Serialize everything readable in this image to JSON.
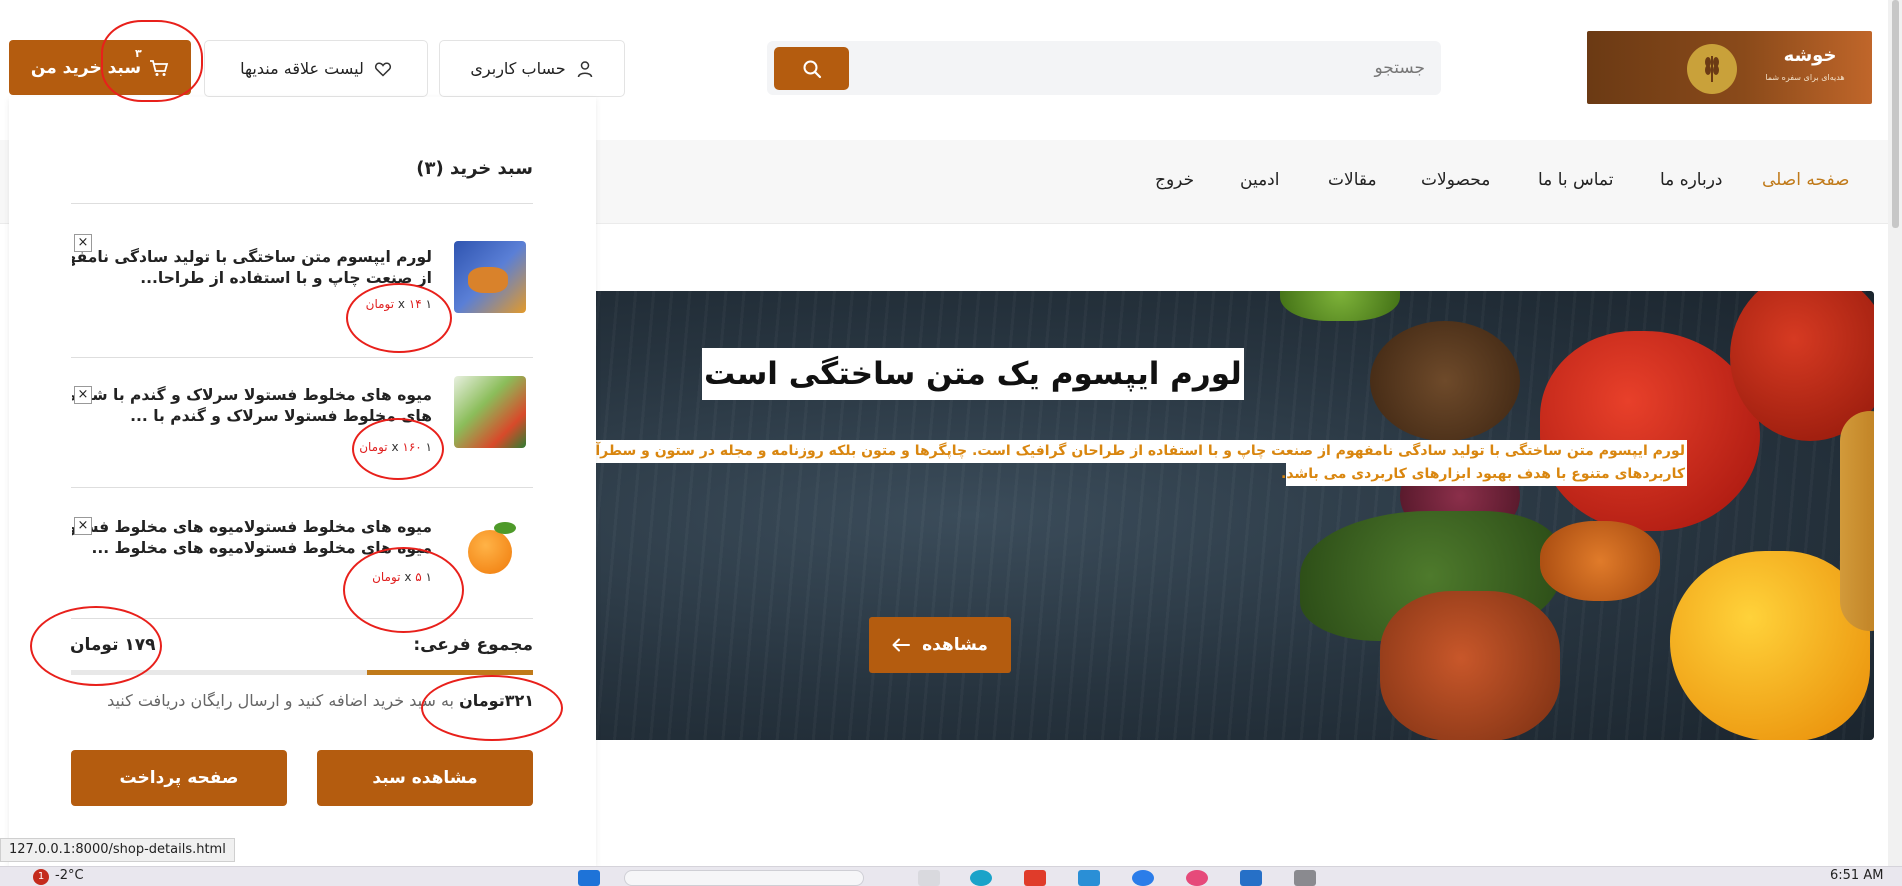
{
  "header": {
    "logo_title": "خوشه",
    "logo_subtitle": "هدیه‌ای برای سفره شما",
    "search_placeholder": "جستجو",
    "account_label": "حساب کاربری",
    "wishlist_label": "لیست علاقه مندیها",
    "cart_label": "سبد خرید من",
    "cart_count": "۳"
  },
  "nav": {
    "items": [
      "صفحه اصلی",
      "درباره ما",
      "تماس با ما",
      "محصولات",
      "مقالات",
      "ادمین",
      "خروج"
    ],
    "active_color": "#c07a1a"
  },
  "hero": {
    "title": "لورم ایپسوم یک متن ساختگی است",
    "desc_line1": "لورم ایپسوم متن ساختگی با تولید سادگی نامفهوم از صنعت چاپ و با استفاده از طراحان گرافیک است. چاپگرها و متون بلکه روزنامه و مجله در ستون و سطرآنچنان",
    "desc_line2": "کاربردهای متنوع با هدف بهبود ابزارهای کاربردی می باشد.",
    "button_label": "مشاهده"
  },
  "cart": {
    "title": "سبد خرید (۳)",
    "items": [
      {
        "name_line1": "لورم ایپسوم متن ساختگی با تولید سادگی نامفهوم",
        "name_line2": "از صنعت چاپ و با استفاده از طراحا...",
        "qty": "۱ x",
        "price": "۱۴ تومان",
        "remove": "×"
      },
      {
        "name_line1": "میوه های مخلوط فستولا سرلاک و گندم با شیرمیوه",
        "name_line2": "های مخلوط فستولا سرلاک و گندم با ...",
        "qty": "۱ x",
        "price": "۱۶۰ تومان",
        "remove": "×"
      },
      {
        "name_line1": "میوه های مخلوط فستولامیوه های مخلوط فستولا",
        "name_line2": "میوه های مخلوط فستولامیوه های مخلوط ...",
        "qty": "۱ x",
        "price": "۵ تومان",
        "remove": "×"
      }
    ],
    "subtotal_label": "مجموع فرعی:",
    "subtotal_value": "۱۷۹ تومان",
    "free_shipping_progress": 0.36,
    "free_ship_amount": "۳۲۱تومان",
    "free_ship_text": "به سبد خرید اضافه کنید و ارسال رایگان دریافت کنید",
    "view_cart_label": "مشاهده سبد",
    "checkout_label": "صفحه پرداخت"
  },
  "status_bar": {
    "url": "127.0.0.1:8000/shop-details.html"
  },
  "taskbar": {
    "temperature": "-2°C",
    "notification_count": "1",
    "time": "6:51 AM"
  },
  "colors": {
    "brand": "#b45c0f",
    "accent_text": "#d9860f",
    "price_red": "#e02020",
    "annotation_red": "#e8201b"
  }
}
